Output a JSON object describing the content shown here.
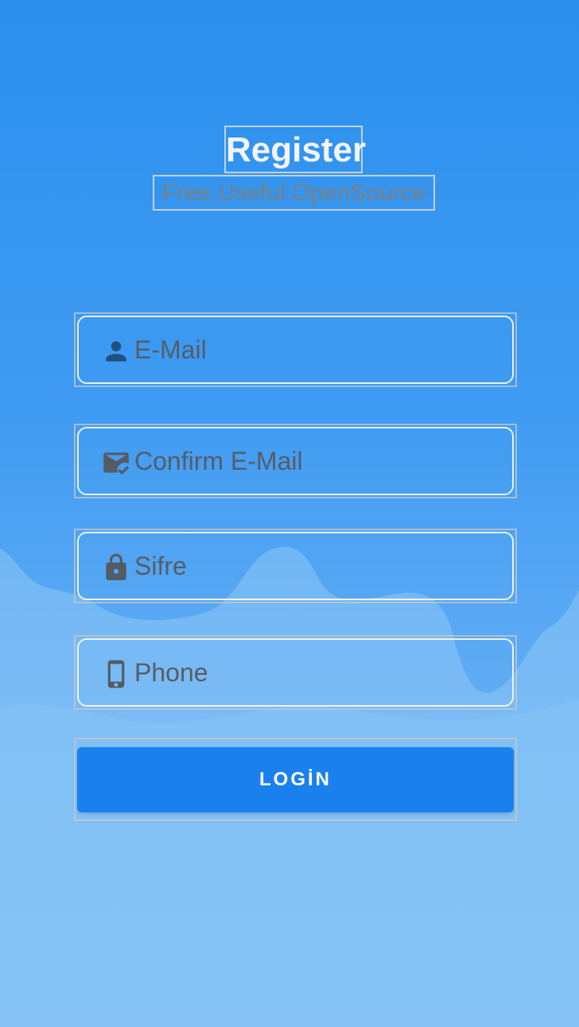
{
  "header": {
    "title": "Register",
    "subtitle": "Free.Useful.OpenSource"
  },
  "form": {
    "fields": [
      {
        "placeholder": "E-Mail",
        "icon": "person-icon"
      },
      {
        "placeholder": "Confirm E-Mail",
        "icon": "mail-check-icon"
      },
      {
        "placeholder": "Sifre",
        "icon": "lock-icon"
      },
      {
        "placeholder": "Phone",
        "icon": "phone-icon"
      }
    ],
    "login_label": "LOGİN"
  },
  "colors": {
    "background_top": "#2b90ef",
    "background_bottom": "#84c2f5",
    "button": "#1a80ee",
    "icon": "#555b63",
    "email_icon": "#20517d"
  }
}
